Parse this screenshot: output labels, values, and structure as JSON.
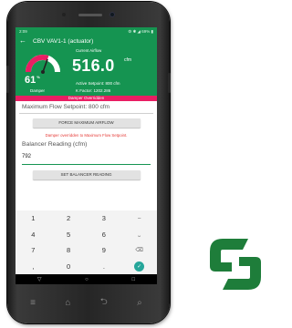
{
  "status_bar": {
    "time": "2:09",
    "right": "⚙ ✱ ◢ 69% ▮"
  },
  "app_bar": {
    "back_icon": "arrow-left-icon",
    "title": "CBV VAV1-1 (actuator)"
  },
  "damper": {
    "percent": "61",
    "percent_unit": "%",
    "label": "Damper",
    "gauge_fraction": 0.61
  },
  "airflow": {
    "label": "Current Airflow",
    "value": "516.0",
    "unit": "cfm",
    "setpoint_text": "Active Setpoint: 800  cfm",
    "kfactor_text": "K Factor: 1202.286"
  },
  "override_banner": "Damper Overridden",
  "max_flow_setpoint": "Maximum Flow Setpoint: 800  cfm",
  "force_button": "FORCE MAXIMUM AIRFLOW",
  "override_message": "Damper overridden to Maximum Flow Setpoint.",
  "balancer": {
    "label": "Balancer Reading (cfm)",
    "value": "792",
    "button": "SET BALANCER READING"
  },
  "keypad": {
    "keys": [
      "1",
      "2",
      "3",
      "–",
      "4",
      "5",
      "6",
      "⎵",
      "7",
      "8",
      "9",
      "⌫",
      ",",
      "0",
      ".",
      "✓"
    ]
  },
  "nav": {
    "back": "▽",
    "home": "○",
    "recents": "□"
  },
  "hw_nav": {
    "menu": "≡",
    "home": "⌂",
    "back": "⮌",
    "search": "⌕"
  },
  "colors": {
    "primary": "#159451",
    "accent": "#e91e63",
    "enter": "#26a69a",
    "logo": "#1e7d3a"
  }
}
